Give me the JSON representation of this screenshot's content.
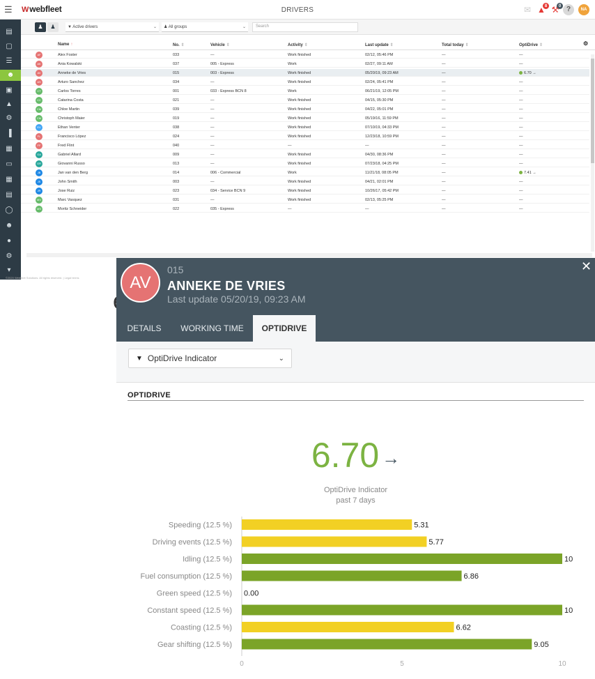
{
  "app": {
    "logo": "webfleet",
    "page_title": "DRIVERS"
  },
  "topbar": {
    "icons": [
      {
        "name": "message-icon",
        "badge": ""
      },
      {
        "name": "alert-icon",
        "badge": "8"
      },
      {
        "name": "wrench-icon",
        "badge": "0"
      },
      {
        "name": "help-icon"
      }
    ],
    "help_label": "?",
    "user_initials": "NA"
  },
  "toolbar": {
    "driver_filter": "Active drivers",
    "group_filter": "All groups",
    "search_placeholder": "Search"
  },
  "table": {
    "columns": [
      "Name",
      "No.",
      "Vehicle",
      "Activity",
      "Last update",
      "Total today",
      "OptiDrive"
    ],
    "rows": [
      {
        "initials": "AF",
        "color": "#e57373",
        "name": "Alex Foster",
        "no": "033",
        "vehicle": "—",
        "activity": "Work finished",
        "last_update": "02/12, 05:46 PM",
        "total": "—",
        "opti": "—",
        "good": false
      },
      {
        "initials": "AK",
        "color": "#e57373",
        "name": "Ania Kowalski",
        "no": "037",
        "vehicle": "005 - Express",
        "activity": "Work",
        "last_update": "02/27, 09:11 AM",
        "total": "—",
        "opti": "—",
        "good": false
      },
      {
        "initials": "AV",
        "color": "#e57373",
        "name": "Anneke de Vries",
        "no": "015",
        "vehicle": "003 - Express",
        "activity": "Work finished",
        "last_update": "05/20/19, 09:23 AM",
        "total": "—",
        "opti": "6.70",
        "good": true,
        "selected": true
      },
      {
        "initials": "AS",
        "color": "#e57373",
        "name": "Arturo Sanchez",
        "no": "034",
        "vehicle": "—",
        "activity": "Work finished",
        "last_update": "02/24, 05:41 PM",
        "total": "—",
        "opti": "—",
        "good": false
      },
      {
        "initials": "CT",
        "color": "#66bb6a",
        "name": "Carlos Torres",
        "no": "001",
        "vehicle": "033 - Express BCN 8",
        "activity": "Work",
        "last_update": "06/21/19, 12:05 PM",
        "total": "—",
        "opti": "—",
        "good": false
      },
      {
        "initials": "CC",
        "color": "#66bb6a",
        "name": "Catarina Costa",
        "no": "021",
        "vehicle": "—",
        "activity": "Work finished",
        "last_update": "04/15, 05:30 PM",
        "total": "—",
        "opti": "—",
        "good": false
      },
      {
        "initials": "CM",
        "color": "#66bb6a",
        "name": "Chloe Martin",
        "no": "039",
        "vehicle": "—",
        "activity": "Work finished",
        "last_update": "04/22, 05:01 PM",
        "total": "—",
        "opti": "—",
        "good": false
      },
      {
        "initials": "CM",
        "color": "#66bb6a",
        "name": "Christoph Maier",
        "no": "019",
        "vehicle": "—",
        "activity": "Work finished",
        "last_update": "05/19/16, 11:59 PM",
        "total": "—",
        "opti": "—",
        "good": false
      },
      {
        "initials": "EV",
        "color": "#42a5f5",
        "name": "Ethan Venter",
        "no": "038",
        "vehicle": "—",
        "activity": "Work finished",
        "last_update": "07/10/19, 04:33 PM",
        "total": "—",
        "opti": "—",
        "good": false
      },
      {
        "initials": "FL",
        "color": "#e57373",
        "name": "Francisco López",
        "no": "024",
        "vehicle": "—",
        "activity": "Work finished",
        "last_update": "12/23/18, 10:59 PM",
        "total": "—",
        "opti": "—",
        "good": false
      },
      {
        "initials": "FF",
        "color": "#e57373",
        "name": "Fred Flint",
        "no": "040",
        "vehicle": "—",
        "activity": "—",
        "last_update": "—",
        "total": "—",
        "opti": "—",
        "good": false
      },
      {
        "initials": "GA",
        "color": "#26a69a",
        "name": "Gabriel Allard",
        "no": "009",
        "vehicle": "—",
        "activity": "Work finished",
        "last_update": "04/30, 08:36 PM",
        "total": "—",
        "opti": "—",
        "good": false
      },
      {
        "initials": "GR",
        "color": "#26a69a",
        "name": "Giovanni Russo",
        "no": "013",
        "vehicle": "—",
        "activity": "Work finished",
        "last_update": "07/23/18, 04:25 PM",
        "total": "—",
        "opti": "—",
        "good": false
      },
      {
        "initials": "JB",
        "color": "#1e88e5",
        "name": "Jan van den Berg",
        "no": "014",
        "vehicle": "006 - Commercial",
        "activity": "Work",
        "last_update": "11/21/18, 08:05 PM",
        "total": "—",
        "opti": "7.41",
        "good": true
      },
      {
        "initials": "JS",
        "color": "#1e88e5",
        "name": "John Smith",
        "no": "003",
        "vehicle": "—",
        "activity": "Work finished",
        "last_update": "04/21, 02:01 PM",
        "total": "—",
        "opti": "—",
        "good": false
      },
      {
        "initials": "JR",
        "color": "#1e88e5",
        "name": "Jose Ruiz",
        "no": "023",
        "vehicle": "034 - Service BCN 9",
        "activity": "Work finished",
        "last_update": "10/26/17, 05:42 PM",
        "total": "—",
        "opti": "—",
        "good": false
      },
      {
        "initials": "MV",
        "color": "#66bb6a",
        "name": "Marc Vasquez",
        "no": "031",
        "vehicle": "—",
        "activity": "Work finished",
        "last_update": "02/13, 05:25 PM",
        "total": "—",
        "opti": "—",
        "good": false
      },
      {
        "initials": "MS",
        "color": "#66bb6a",
        "name": "Moritz Schneider",
        "no": "022",
        "vehicle": "035 - Express",
        "activity": "—",
        "last_update": "—",
        "total": "—",
        "opti": "—",
        "good": false
      }
    ]
  },
  "footer": {
    "text": "©2020 Webfleet Solutions. All rights reserved.  |  Legal terms"
  },
  "background_fragment": "e",
  "panel": {
    "initials": "AV",
    "number": "015",
    "name": "ANNEKE DE VRIES",
    "last_update": "Last update 05/20/19, 09:23 AM",
    "tabs": [
      "DETAILS",
      "WORKING TIME",
      "OPTIDRIVE"
    ],
    "active_tab": "OPTIDRIVE",
    "indicator_select": "OptiDrive Indicator",
    "section_title": "OPTIDRIVE",
    "score": "6.70",
    "score_color": "#7cb342",
    "trend": "→",
    "score_label_1": "OptiDrive Indicator",
    "score_label_2": "past 7 days"
  },
  "chart_data": {
    "type": "bar",
    "orientation": "horizontal",
    "categories": [
      "Speeding (12.5 %)",
      "Driving events (12.5 %)",
      "Idling (12.5 %)",
      "Fuel consumption (12.5 %)",
      "Green speed (12.5 %)",
      "Constant speed (12.5 %)",
      "Coasting (12.5 %)",
      "Gear shifting (12.5 %)"
    ],
    "values": [
      5.31,
      5.77,
      10,
      6.86,
      0.0,
      10,
      6.62,
      9.05
    ],
    "value_labels": [
      "5.31",
      "5.77",
      "10",
      "6.86",
      "0.00",
      "10",
      "6.62",
      "9.05"
    ],
    "bar_colors": [
      "#f2d024",
      "#f2d024",
      "#7ba428",
      "#7ba428",
      "#7ba428",
      "#7ba428",
      "#f2d024",
      "#7ba428"
    ],
    "xlim": [
      0,
      10
    ],
    "xticks": [
      "0",
      "5",
      "10"
    ],
    "grid": false
  }
}
